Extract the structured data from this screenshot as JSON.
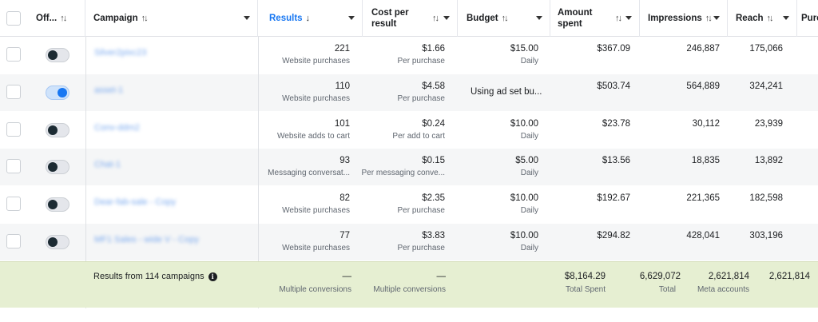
{
  "header": {
    "off_label": "Off...",
    "campaign_label": "Campaign",
    "results_label": "Results",
    "cost_label_line1": "Cost per",
    "cost_label_line2": "result",
    "budget_label": "Budget",
    "amount_label_line1": "Amount",
    "amount_label_line2": "spent",
    "impressions_label": "Impressions",
    "reach_label": "Reach",
    "purchases_label": "Purc"
  },
  "rows": [
    {
      "on": false,
      "campaign": "Silver2pixc23",
      "results": "221",
      "results_type": "Website purchases",
      "cost": "$1.66",
      "cost_type": "Per purchase",
      "budget": "$15.00",
      "budget_type": "Daily",
      "spent": "$367.09",
      "impressions": "246,887",
      "reach": "175,066"
    },
    {
      "on": true,
      "campaign": "asset-1",
      "results": "110",
      "results_type": "Website purchases",
      "cost": "$4.58",
      "cost_type": "Per purchase",
      "budget": "Using ad set bu...",
      "budget_type": "",
      "spent": "$503.74",
      "impressions": "564,889",
      "reach": "324,241"
    },
    {
      "on": false,
      "campaign": "Conv-ddm2",
      "results": "101",
      "results_type": "Website adds to cart",
      "cost": "$0.24",
      "cost_type": "Per add to cart",
      "budget": "$10.00",
      "budget_type": "Daily",
      "spent": "$23.78",
      "impressions": "30,112",
      "reach": "23,939"
    },
    {
      "on": false,
      "campaign": "Chat-1",
      "results": "93",
      "results_type": "Messaging conversat...",
      "cost": "$0.15",
      "cost_type": "Per messaging conve...",
      "budget": "$5.00",
      "budget_type": "Daily",
      "spent": "$13.56",
      "impressions": "18,835",
      "reach": "13,892"
    },
    {
      "on": false,
      "campaign": "Dear-fab-sale - Copy",
      "results": "82",
      "results_type": "Website purchases",
      "cost": "$2.35",
      "cost_type": "Per purchase",
      "budget": "$10.00",
      "budget_type": "Daily",
      "spent": "$192.67",
      "impressions": "221,365",
      "reach": "182,598"
    },
    {
      "on": false,
      "campaign": "MF1 Sales - wide V - Copy",
      "results": "77",
      "results_type": "Website purchases",
      "cost": "$3.83",
      "cost_type": "Per purchase",
      "budget": "$10.00",
      "budget_type": "Daily",
      "spent": "$294.82",
      "impressions": "428,041",
      "reach": "303,196"
    }
  ],
  "footer": {
    "title": "Results from 114 campaigns",
    "results_dash": "—",
    "results_type": "Multiple conversions",
    "cost_dash": "—",
    "cost_type": "Multiple conversions",
    "spent": "$8,164.29",
    "spent_type": "Total Spent",
    "impressions": "6,629,072",
    "impressions_type": "Total",
    "reach": "2,621,814",
    "reach_type": "Meta accounts",
    "purchases": "2,621,814"
  }
}
